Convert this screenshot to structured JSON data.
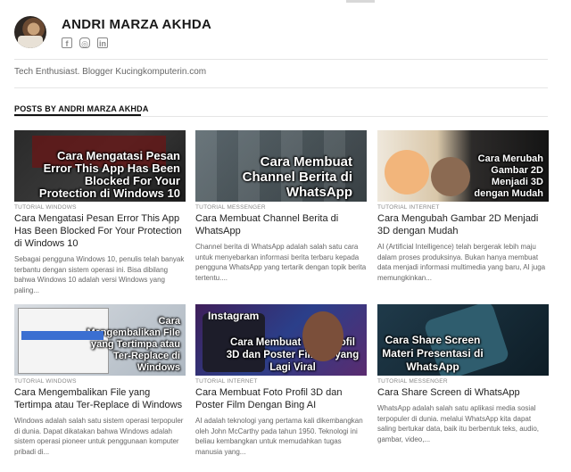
{
  "author": {
    "name": "ANDRI MARZA AKHDA",
    "bio": "Tech Enthusiast. Blogger Kucingkomputerin.com",
    "social": [
      {
        "icon": "facebook-icon",
        "glyph": "f"
      },
      {
        "icon": "instagram-icon",
        "glyph": "◎"
      },
      {
        "icon": "linkedin-icon",
        "glyph": "in"
      }
    ]
  },
  "section_title": "POSTS BY ANDRI MARZA AKHDA",
  "posts": [
    {
      "thumb_caption": "Cara Mengatasi Pesan Error This App Has Been Blocked For Your Protection di Windows 10",
      "category": "TUTORIAL WINDOWS",
      "title": "Cara Mengatasi Pesan Error This App Has Been Blocked For Your Protection di Windows 10",
      "excerpt": "Sebagai pengguna Windows 10, penulis telah banyak terbantu dengan sistem operasi ini. Bisa dibilang bahwa Windows 10 adalah versi Windows yang paling..."
    },
    {
      "thumb_caption": "Cara Membuat Channel Berita di WhatsApp",
      "category": "TUTORIAL MESSENGER",
      "title": "Cara Membuat Channel Berita di WhatsApp",
      "excerpt": "Channel berita di WhatsApp adalah salah satu cara untuk menyebarkan informasi berita terbaru kepada pengguna WhatsApp yang tertarik dengan topik berita tertentu...."
    },
    {
      "thumb_caption": "Cara Merubah Gambar 2D Menjadi 3D dengan Mudah",
      "category": "TUTORIAL INTERNET",
      "title": "Cara Mengubah Gambar 2D Menjadi 3D dengan Mudah",
      "excerpt": "AI  (Artificial Intelligence) telah bergerak lebih maju dalam proses produksinya. Bukan hanya membuat data menjadi informasi multimedia yang baru, AI juga memungkinkan..."
    },
    {
      "thumb_caption": "Cara Mengembalikan File yang Tertimpa atau Ter-Replace di Windows",
      "category": "TUTORIAL WINDOWS",
      "title": "Cara Mengembalikan File yang Tertimpa atau Ter-Replace di Windows",
      "excerpt": "Windows adalah salah satu sistem operasi terpopuler di dunia. Dapat dikatakan bahwa Windows adalah sistem operasi pioneer untuk penggunaan komputer pribadi di..."
    },
    {
      "thumb_caption": "Cara Membuat Foto Profil 3D dan Poster Film AI yang Lagi Viral",
      "thumb_tag": "Instagram",
      "category": "TUTORIAL INTERNET",
      "title": "Cara Membuat Foto Profil 3D dan Poster Film Dengan Bing AI",
      "excerpt": "AI adalah teknologi yang pertama kali dikembangkan oleh John McCarthy pada tahun 1950. Teknologi ini beliau kembangkan untuk memudahkan tugas manusia yang..."
    },
    {
      "thumb_caption": "Cara Share Screen Materi Presentasi di WhatsApp",
      "category": "TUTORIAL MESSENGER",
      "title": "Cara Share Screen di WhatsApp",
      "excerpt": "WhatsApp adalah salah satu aplikasi media sosial terpopuler di dunia. melalui WhatsApp kita dapat saling bertukar data, baik itu berbentuk teks, audio, gambar, video,..."
    }
  ]
}
